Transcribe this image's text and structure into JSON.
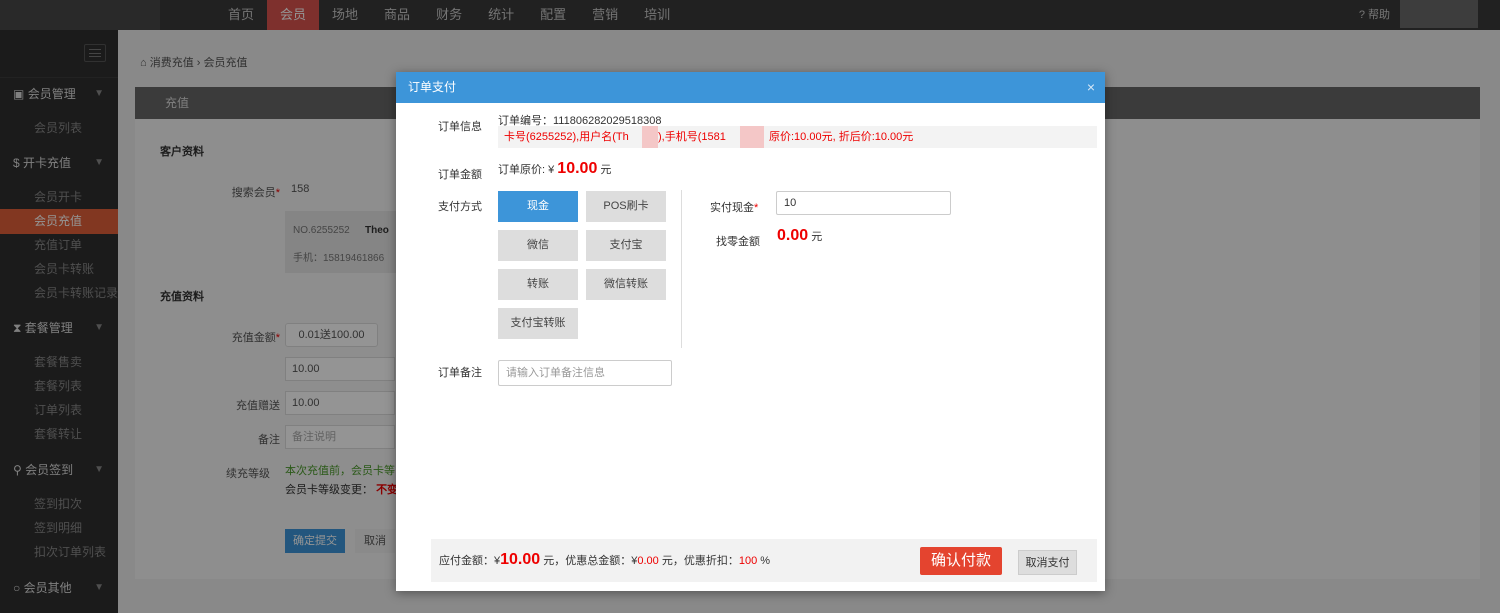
{
  "nav": {
    "items": [
      "首页",
      "会员",
      "场地",
      "商品",
      "财务",
      "统计",
      "配置",
      "营销",
      "培训"
    ],
    "active": "会员",
    "help_label": "帮助"
  },
  "sidebar": {
    "groups": [
      "会员管理",
      "开卡充值",
      "套餐管理",
      "会员签到",
      "会员其他"
    ],
    "items": {
      "member_list": "会员列表",
      "open_card": "会员开卡",
      "recharge": "会员充值",
      "recharge_orders": "充值订单",
      "card_transfer": "会员卡转账",
      "card_transfer_log": "会员卡转账记录",
      "package_sell": "套餐售卖",
      "package_list": "套餐列表",
      "order_list": "订单列表",
      "package_transfer": "套餐转让",
      "checkin_deduct": "签到扣次",
      "checkin_detail": "签到明细",
      "deduct_order_list": "扣次订单列表"
    }
  },
  "breadcrumb": "消费充值 › 会员充值",
  "panel": {
    "title": "充值",
    "customer_section": "客户资料",
    "search_label": "搜索会员",
    "search_value": "158",
    "card_no": "NO.6255252",
    "card_name": "Theo",
    "phone": "手机：15819461866",
    "recharge_section": "充值资料",
    "amount_label": "充值金额",
    "amount_value": "0.01送100.00",
    "amount_field": "10.00",
    "bonus_label": "充值赠送",
    "bonus_value": "10.00",
    "remark_label": "备注",
    "remark_placeholder": "备注说明",
    "level_label": "续充等级",
    "level_hint": "本次充值前，会员卡等",
    "level_change": "会员卡等级变更：",
    "level_change_value": "不变",
    "submit": "确定提交",
    "cancel": "取消"
  },
  "modal": {
    "title": "订单支付",
    "order_info_label": "订单信息",
    "order_no": "订单编号：111806282029518308",
    "order_detail_left": "卡号(6255252),用户名(Th",
    "order_detail_mid": "),手机号(1581",
    "order_detail_right": "原价:10.00元, 折后价:10.00元",
    "amount_label": "订单金额",
    "amount_prefix": "订单原价: ¥",
    "amount_value": "10.00",
    "amount_unit": "元",
    "pay_method_label": "支付方式",
    "pay_methods": [
      "现金",
      "POS刷卡",
      "微信",
      "支付宝",
      "转账",
      "微信转账",
      "支付宝转账"
    ],
    "cash_label": "实付现金",
    "cash_value": "10",
    "change_label": "找零金额",
    "change_value": "0.00",
    "change_unit": "元",
    "remark_label": "订单备注",
    "remark_placeholder": "请输入订单备注信息",
    "footer": {
      "payable_label": "应付金额：¥",
      "payable_value": "10.00",
      "payable_unit": "元，优惠总金额：¥",
      "discount_total": "0.00",
      "discount_unit": "元，优惠折扣：",
      "discount_rate": "100",
      "percent": "%",
      "confirm": "确认付款",
      "cancel": "取消支付"
    }
  },
  "colors": {
    "accent": "#3d95d9",
    "danger": "#e4442f",
    "nav_active": "#d9534f",
    "sidebar_active": "#e0603a"
  }
}
